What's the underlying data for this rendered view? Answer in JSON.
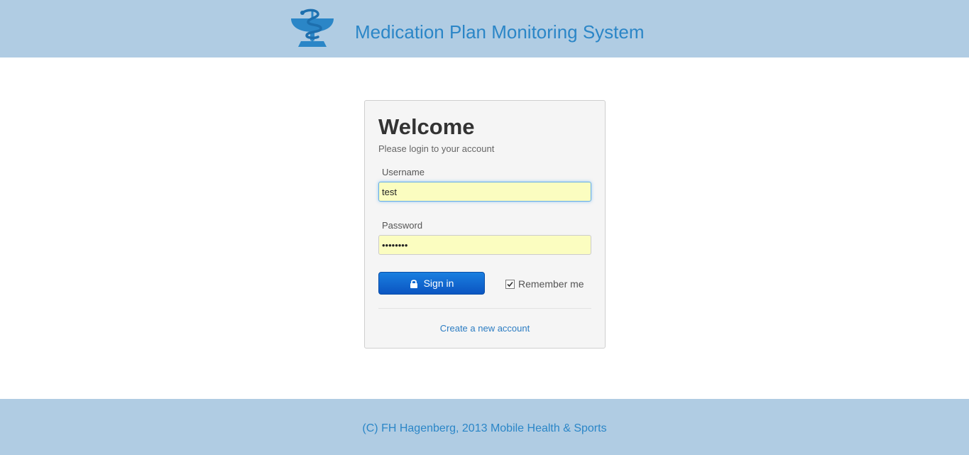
{
  "header": {
    "title": "Medication Plan Monitoring System",
    "logo_icon": "caduceus-bowl-icon"
  },
  "login": {
    "heading": "Welcome",
    "subtitle": "Please login to your account",
    "username_label": "Username",
    "username_value": "test",
    "password_label": "Password",
    "password_value": "........",
    "signin_label": "Sign in",
    "signin_icon": "lock-icon",
    "remember_label": "Remember me",
    "remember_checked": true,
    "create_account_label": "Create a new account"
  },
  "footer": {
    "text": "(C) FH Hagenberg, 2013 Mobile Health & Sports"
  },
  "colors": {
    "banner": "#b0cce3",
    "accent": "#2b86c7",
    "button": "#0b62d4",
    "field_fill": "#fbfdc0"
  }
}
